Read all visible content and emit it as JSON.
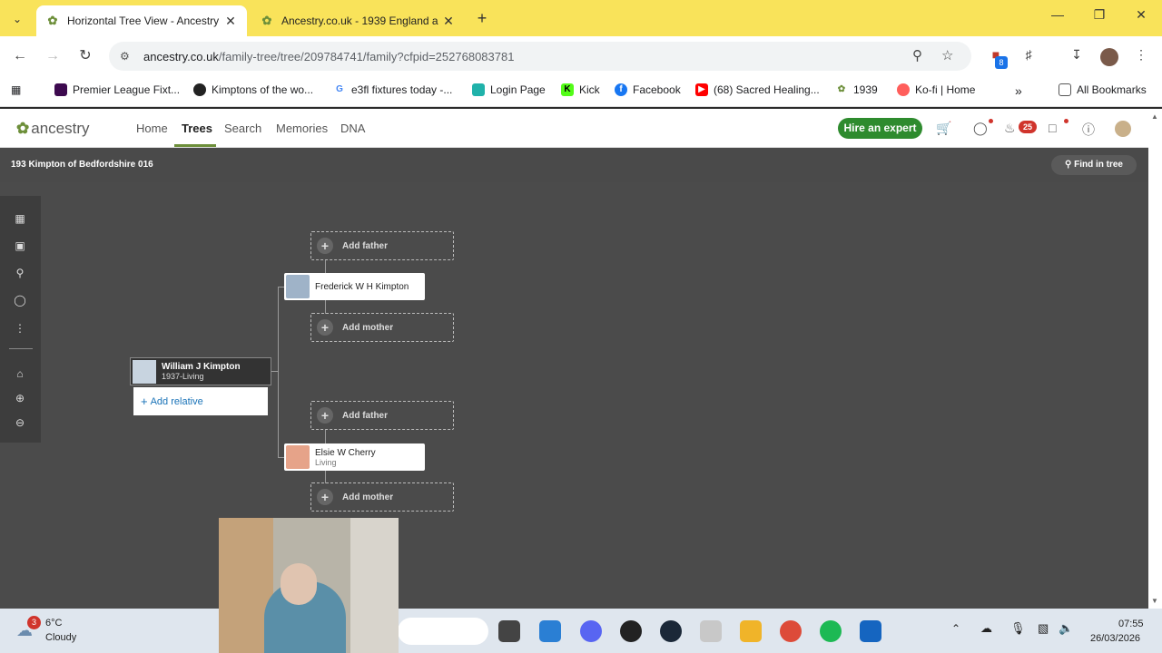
{
  "browser": {
    "tabs": [
      {
        "title": "Horizontal Tree View - Ancestry",
        "active": true
      },
      {
        "title": "Ancestry.co.uk - 1939 England a",
        "active": false
      }
    ],
    "url_host": "ancestry.co.uk",
    "url_path": "/family-tree/tree/209784741/family?cfpid=252768083781",
    "extension_badge": "8",
    "bookmarks": [
      {
        "label": "Premier League Fixt...",
        "icon": "premier-league-icon",
        "color": "#3d0a4f"
      },
      {
        "label": "Kimptons of the wo...",
        "icon": "globe-icon",
        "color": "#222222"
      },
      {
        "label": "e3fl fixtures today -...",
        "icon": "google-icon",
        "color": "#4285f4"
      },
      {
        "label": "Login Page",
        "icon": "login-icon",
        "color": "#20b2aa"
      },
      {
        "label": "Kick",
        "icon": "kick-icon",
        "color": "#53fc18"
      },
      {
        "label": "Facebook",
        "icon": "facebook-icon",
        "color": "#1877f2"
      },
      {
        "label": "(68) Sacred Healing...",
        "icon": "youtube-icon",
        "color": "#ff0000"
      },
      {
        "label": "1939",
        "icon": "ancestry-leaf-icon",
        "color": "#6d8f3a"
      },
      {
        "label": "Ko-fi | Home",
        "icon": "kofi-icon",
        "color": "#ff5e5b"
      }
    ],
    "all_bookmarks": "All Bookmarks"
  },
  "ancestry": {
    "logo": "ancestry",
    "nav": [
      "Home",
      "Trees",
      "Search",
      "Memories",
      "DNA"
    ],
    "active_nav": "Trees",
    "hire_button": "Hire an expert",
    "notification_count": "25",
    "tree_name": "193 Kimpton of Bedfordshire 016",
    "find_in_tree": "Find in tree"
  },
  "tree": {
    "focus": {
      "name": "William J Kimpton",
      "dates": "1937-Living"
    },
    "add_relative": "Add relative",
    "father": {
      "name": "Frederick W H Kimpton",
      "dates": ""
    },
    "mother": {
      "name": "Elsie W Cherry",
      "dates": "Living"
    },
    "add_father": "Add father",
    "add_mother": "Add mother"
  },
  "taskbar": {
    "weather_badge": "3",
    "temperature": "6°C",
    "condition": "Cloudy",
    "time": "07:55",
    "date": "26/03/2026"
  },
  "colors": {
    "tabbar": "#f9e35a",
    "ancestry_green": "#6d8f3a",
    "hire_green": "#2e8b2e",
    "canvas": "#4b4b4b"
  }
}
